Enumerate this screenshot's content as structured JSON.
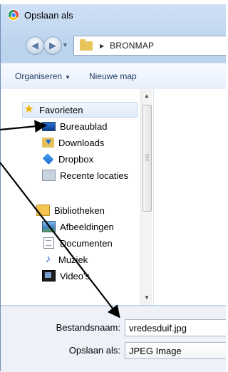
{
  "window": {
    "title": "Opslaan als"
  },
  "address": {
    "crumb": "BRONMAP"
  },
  "toolbar": {
    "organize_label": "Organiseren",
    "new_folder_label": "Nieuwe map"
  },
  "nav": {
    "favorites": [
      {
        "label": "Favorieten",
        "icon": "star-icon"
      },
      {
        "label": "Bureaublad",
        "icon": "desktop-icon"
      },
      {
        "label": "Downloads",
        "icon": "downloads-folder-icon"
      },
      {
        "label": "Dropbox",
        "icon": "dropbox-icon"
      },
      {
        "label": "Recente locaties",
        "icon": "recent-places-icon"
      }
    ],
    "libraries": [
      {
        "label": "Bibliotheken",
        "icon": "libraries-icon"
      },
      {
        "label": "Afbeeldingen",
        "icon": "pictures-icon"
      },
      {
        "label": "Documenten",
        "icon": "documents-icon"
      },
      {
        "label": "Muziek",
        "icon": "music-icon"
      },
      {
        "label": "Video's",
        "icon": "videos-icon"
      }
    ]
  },
  "save": {
    "filename_label": "Bestandsnaam:",
    "filename_value": "vredesduif.jpg",
    "type_label": "Opslaan als:",
    "type_value": "JPEG Image"
  },
  "colors": {
    "accent": "#1e3a5f",
    "arrow": "#000000"
  }
}
